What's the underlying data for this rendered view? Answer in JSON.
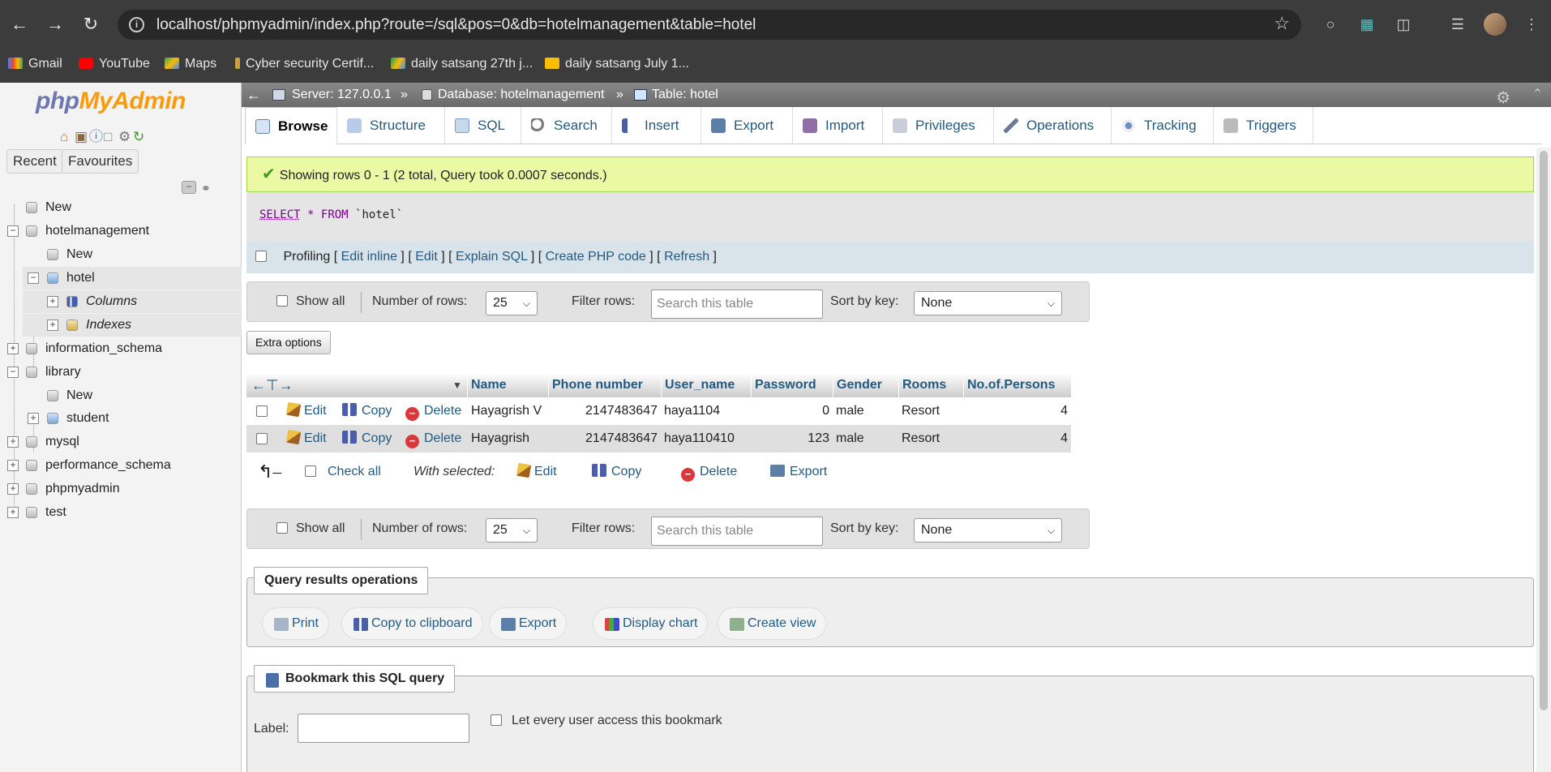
{
  "browser": {
    "url": "localhost/phpmyadmin/index.php?route=/sql&pos=0&db=hotelmanagement&table=hotel",
    "bookmarks": [
      "Gmail",
      "YouTube",
      "Maps",
      "Cyber security Certif...",
      "daily satsang 27th j...",
      "daily satsang July 1..."
    ]
  },
  "sidebar": {
    "logo_php": "php",
    "logo_myadmin": "MyAdmin",
    "tabs": [
      "Recent",
      "Favourites"
    ],
    "tree": [
      {
        "label": "New",
        "level": 0
      },
      {
        "label": "hotelmanagement",
        "level": 0
      },
      {
        "label": "New",
        "level": 1
      },
      {
        "label": "hotel",
        "level": 1
      },
      {
        "label": "Columns",
        "level": 2
      },
      {
        "label": "Indexes",
        "level": 2
      },
      {
        "label": "information_schema",
        "level": 0
      },
      {
        "label": "library",
        "level": 0
      },
      {
        "label": "New",
        "level": 1
      },
      {
        "label": "student",
        "level": 1
      },
      {
        "label": "mysql",
        "level": 0
      },
      {
        "label": "performance_schema",
        "level": 0
      },
      {
        "label": "phpmyadmin",
        "level": 0
      },
      {
        "label": "test",
        "level": 0
      }
    ]
  },
  "breadcrumb": {
    "server": "Server: 127.0.0.1",
    "database": "Database: hotelmanagement",
    "table": "Table: hotel",
    "sep": "»"
  },
  "tabs": [
    "Browse",
    "Structure",
    "SQL",
    "Search",
    "Insert",
    "Export",
    "Import",
    "Privileges",
    "Operations",
    "Tracking",
    "Triggers"
  ],
  "message": "Showing rows 0 - 1 (2 total, Query took 0.0007 seconds.)",
  "sql": {
    "select": "SELECT",
    "star": "*",
    "from": "FROM",
    "table": "`hotel`"
  },
  "profiling": {
    "label": "Profiling",
    "links": [
      "Edit inline",
      "Edit",
      "Explain SQL",
      "Create PHP code",
      "Refresh"
    ]
  },
  "nav": {
    "show_all": "Show all",
    "num_rows_label": "Number of rows:",
    "num_rows_value": "25",
    "filter_label": "Filter rows:",
    "filter_placeholder": "Search this table",
    "sort_label": "Sort by key:",
    "sort_value": "None"
  },
  "extra_options": "Extra options",
  "columns": [
    "Name",
    "Phone number",
    "User_name",
    "Password",
    "Gender",
    "Rooms",
    "No.of.Persons"
  ],
  "rows": [
    {
      "name": "Hayagrish V",
      "phone": "2147483647",
      "user": "haya1104",
      "password": "0",
      "gender": "male",
      "rooms": "Resort",
      "persons": "4"
    },
    {
      "name": "Hayagrish",
      "phone": "2147483647",
      "user": "haya110410",
      "password": "123",
      "gender": "male",
      "rooms": "Resort",
      "persons": "4"
    }
  ],
  "row_actions": {
    "edit": "Edit",
    "copy": "Copy",
    "delete": "Delete"
  },
  "with_selected": {
    "check_all": "Check all",
    "label": "With selected:",
    "edit": "Edit",
    "copy": "Copy",
    "delete": "Delete",
    "export": "Export"
  },
  "query_ops": {
    "title": "Query results operations",
    "buttons": [
      "Print",
      "Copy to clipboard",
      "Export",
      "Display chart",
      "Create view"
    ]
  },
  "bookmark": {
    "title": "Bookmark this SQL query",
    "label": "Label:",
    "share": "Let every user access this bookmark"
  }
}
